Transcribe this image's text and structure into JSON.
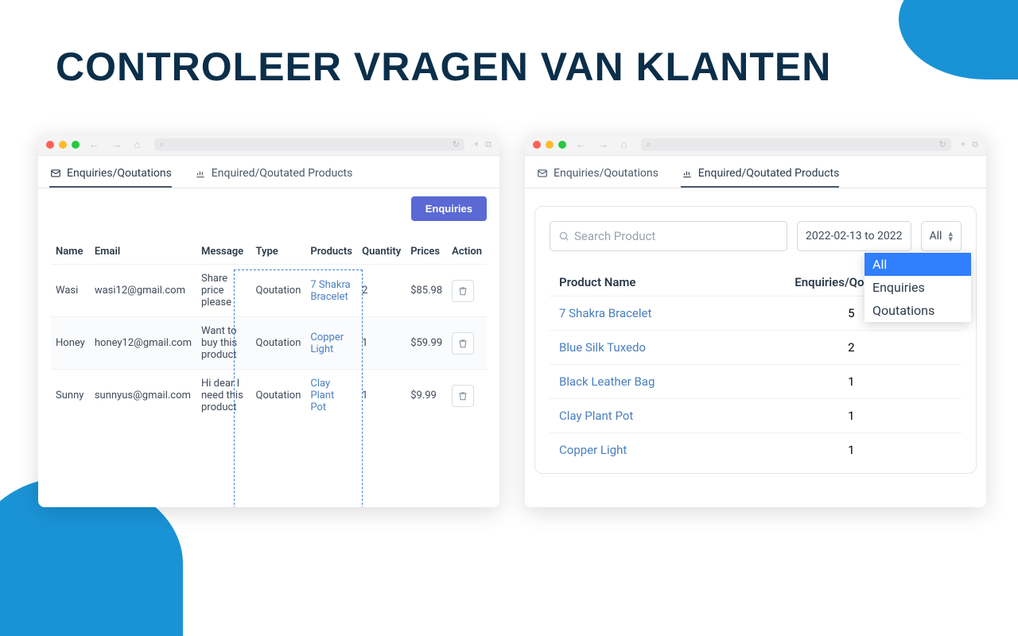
{
  "page": {
    "title": "CONTROLEER VRAGEN VAN KLANTEN"
  },
  "tabs": {
    "enquiries": "Enquiries/Qoutations",
    "products": "Enquired/Qoutated Products"
  },
  "left": {
    "enquiries_button": "Enquiries",
    "columns": {
      "name": "Name",
      "email": "Email",
      "message": "Message",
      "type": "Type",
      "products": "Products",
      "quantity": "Quantity",
      "prices": "Prices",
      "action": "Action"
    },
    "rows": [
      {
        "name": "Wasi",
        "email": "wasi12@gmail.com",
        "message": "Share price please",
        "type": "Qoutation",
        "product": "7 Shakra Bracelet",
        "quantity": "2",
        "price": "$85.98"
      },
      {
        "name": "Honey",
        "email": "honey12@gmail.com",
        "message": "Want to buy this product",
        "type": "Qoutation",
        "product": "Copper Light",
        "quantity": "1",
        "price": "$59.99"
      },
      {
        "name": "Sunny",
        "email": "sunnyus@gmail.com",
        "message": "Hi dear I need this product",
        "type": "Qoutation",
        "product": "Clay Plant Pot",
        "quantity": "1",
        "price": "$9.99"
      }
    ]
  },
  "right": {
    "search_placeholder": "Search Product",
    "date_range": "2022-02-13 to 2022",
    "filter_selected": "All",
    "filter_options": {
      "all": "All",
      "enquiries": "Enquiries",
      "qoutations": "Qoutations"
    },
    "columns": {
      "product_name": "Product Name",
      "count": "Enquiries/Qoutations"
    },
    "rows": [
      {
        "product": "7 Shakra Bracelet",
        "count": "5"
      },
      {
        "product": "Blue Silk Tuxedo",
        "count": "2"
      },
      {
        "product": "Black Leather Bag",
        "count": "1"
      },
      {
        "product": "Clay Plant Pot",
        "count": "1"
      },
      {
        "product": "Copper Light",
        "count": "1"
      }
    ]
  }
}
